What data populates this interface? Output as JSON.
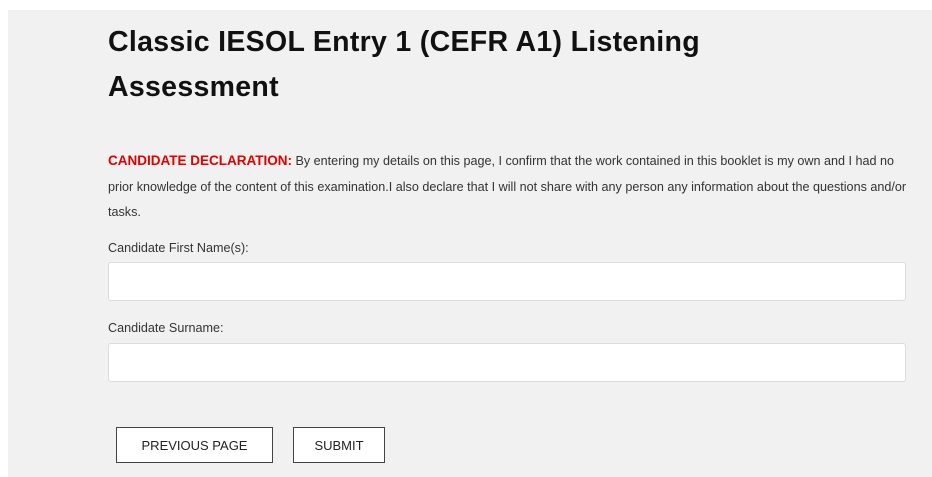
{
  "page": {
    "title": "Classic IESOL Entry 1 (CEFR A1) Listening Assessment"
  },
  "declaration": {
    "label": "CANDIDATE DECLARATION:",
    "text": " By entering my details on this page, I confirm that the work contained in this booklet is my own and I had no prior knowledge of the content of this examination.I also declare that I will not share with any person any information about the questions and/or tasks."
  },
  "form": {
    "first_name": {
      "label": "Candidate First Name(s):",
      "value": "",
      "placeholder": ""
    },
    "surname": {
      "label": "Candidate Surname:",
      "value": "",
      "placeholder": ""
    }
  },
  "buttons": {
    "previous_label": "PREVIOUS PAGE",
    "submit_label": "SUBMIT"
  },
  "colors": {
    "panel_background": "#f1f1f1",
    "declaration_label": "#e00000",
    "title_text": "#111111"
  }
}
